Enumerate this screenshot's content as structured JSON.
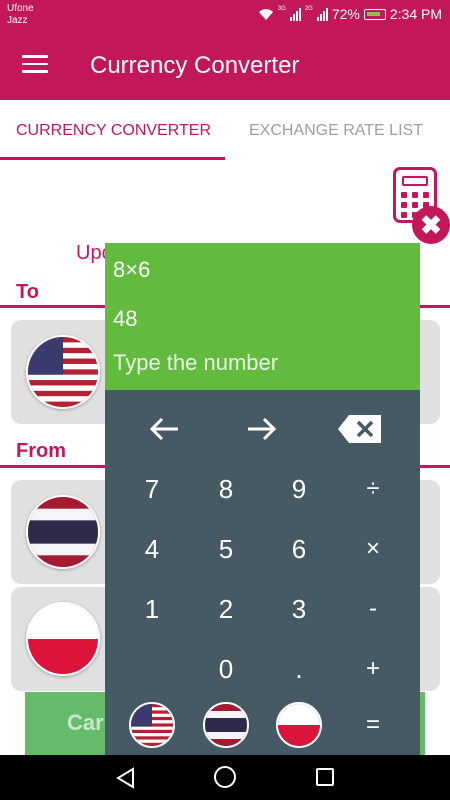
{
  "status_bar": {
    "carrier_line1": "Ufone",
    "carrier_line2": "Jazz",
    "net1": "3G",
    "net2": "2G",
    "battery": "72%",
    "time": "2:34 PM"
  },
  "app_bar": {
    "title": "Currency Converter"
  },
  "tabs": [
    {
      "label": "CURRENCY CONVERTER",
      "active": true
    },
    {
      "label": "EXCHANGE RATE LIST",
      "active": false
    }
  ],
  "page": {
    "update_text": "Upc",
    "to_label": "To",
    "from_label": "From",
    "to_currency_flag": "us-flag-icon",
    "from_currency_flags": [
      "thailand-flag-icon",
      "poland-flag-icon"
    ],
    "calc_button_label": "Car"
  },
  "calculator": {
    "expression": "8×6",
    "result": "48",
    "placeholder": "Type the number",
    "nav_keys": [
      "←",
      "→"
    ],
    "rows": [
      [
        "7",
        "8",
        "9",
        "÷"
      ],
      [
        "4",
        "5",
        "6",
        "×"
      ],
      [
        "1",
        "2",
        "3",
        "-"
      ],
      [
        "",
        "0",
        ".",
        "+"
      ]
    ],
    "equals": "=",
    "flag_keys": [
      "us-flag-icon",
      "thailand-flag-icon",
      "poland-flag-icon"
    ]
  },
  "colors": {
    "primary": "#c2185b",
    "display_green": "#62bb3e",
    "keyboard": "#455a64"
  }
}
